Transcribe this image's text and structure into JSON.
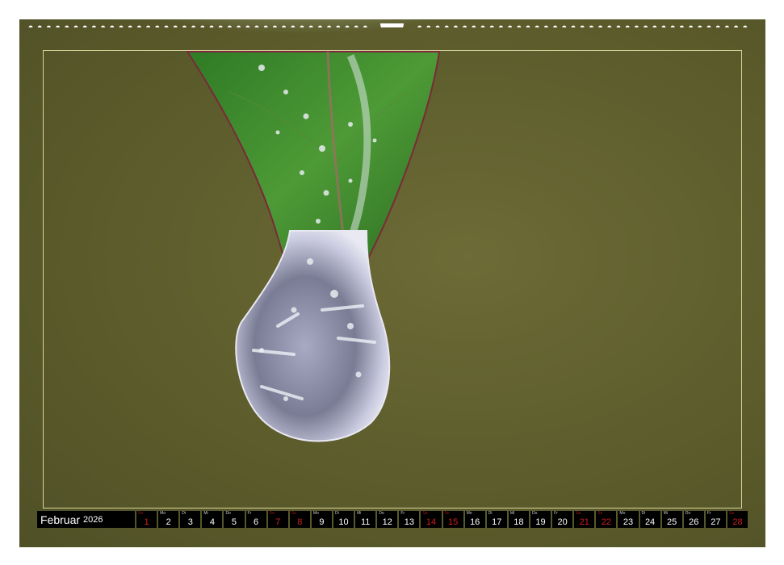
{
  "calendar": {
    "month": "Februar",
    "year": "2026",
    "days": [
      {
        "wd": "So",
        "num": "1",
        "red": true
      },
      {
        "wd": "Mo",
        "num": "2",
        "red": false
      },
      {
        "wd": "Di",
        "num": "3",
        "red": false
      },
      {
        "wd": "Mi",
        "num": "4",
        "red": false
      },
      {
        "wd": "Do",
        "num": "5",
        "red": false
      },
      {
        "wd": "Fr",
        "num": "6",
        "red": false
      },
      {
        "wd": "Sa",
        "num": "7",
        "red": true
      },
      {
        "wd": "So",
        "num": "8",
        "red": true
      },
      {
        "wd": "Mo",
        "num": "9",
        "red": false
      },
      {
        "wd": "Di",
        "num": "10",
        "red": false
      },
      {
        "wd": "Mi",
        "num": "11",
        "red": false
      },
      {
        "wd": "Do",
        "num": "12",
        "red": false
      },
      {
        "wd": "Fr",
        "num": "13",
        "red": false
      },
      {
        "wd": "Sa",
        "num": "14",
        "red": true
      },
      {
        "wd": "So",
        "num": "15",
        "red": true
      },
      {
        "wd": "Mo",
        "num": "16",
        "red": false
      },
      {
        "wd": "Di",
        "num": "17",
        "red": false
      },
      {
        "wd": "Mi",
        "num": "18",
        "red": false
      },
      {
        "wd": "Do",
        "num": "19",
        "red": false
      },
      {
        "wd": "Fr",
        "num": "20",
        "red": false
      },
      {
        "wd": "Sa",
        "num": "21",
        "red": true
      },
      {
        "wd": "So",
        "num": "22",
        "red": true
      },
      {
        "wd": "Mo",
        "num": "23",
        "red": false
      },
      {
        "wd": "Di",
        "num": "24",
        "red": false
      },
      {
        "wd": "Mi",
        "num": "25",
        "red": false
      },
      {
        "wd": "Do",
        "num": "26",
        "red": false
      },
      {
        "wd": "Fr",
        "num": "27",
        "red": false
      },
      {
        "wd": "Sa",
        "num": "28",
        "red": true
      }
    ]
  },
  "colors": {
    "background": "#5c5c2c",
    "frame_line": "#d8d49a",
    "leaf": "#3f8a2e",
    "weekend_red": "#d21f1f"
  }
}
